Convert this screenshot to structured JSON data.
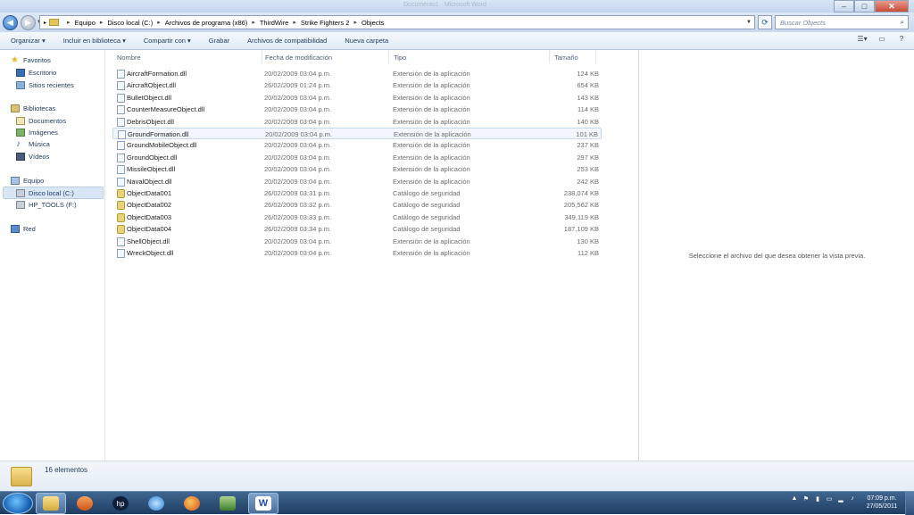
{
  "window": {
    "ghost_title_left": "Documento1 - Microsoft Word",
    "controls": [
      "–",
      "□",
      "✕"
    ]
  },
  "address": {
    "segments": [
      "Equipo",
      "Disco local (C:)",
      "Archivos de programa (x86)",
      "ThirdWire",
      "Strike Fighters 2",
      "Objects"
    ],
    "search_placeholder": "Buscar Objects"
  },
  "toolbar": {
    "organize": "Organizar ▾",
    "include": "Incluir en biblioteca ▾",
    "share": "Compartir con ▾",
    "burn": "Grabar",
    "compat": "Archivos de compatibilidad",
    "newfolder": "Nueva carpeta"
  },
  "sidebar": {
    "favorites": "Favoritos",
    "desktop": "Escritorio",
    "recent": "Sitios recientes",
    "libraries": "Bibliotecas",
    "documents": "Documentos",
    "images": "Imágenes",
    "music": "Música",
    "videos": "Vídeos",
    "computer": "Equipo",
    "localdisk": "Disco local (C:)",
    "hptools": "HP_TOOLS (F:)",
    "network": "Red"
  },
  "columns": {
    "name": "Nombre",
    "date": "Fecha de modificación",
    "type": "Tipo",
    "size": "Tamaño"
  },
  "files": [
    {
      "name": "AircraftFormation.dll",
      "date": "20/02/2009 03:04 p.m.",
      "type": "Extensión de la aplicación",
      "size": "124 KB",
      "kind": "dll"
    },
    {
      "name": "AircraftObject.dll",
      "date": "26/02/2009 01:24 p.m.",
      "type": "Extensión de la aplicación",
      "size": "654 KB",
      "kind": "dll"
    },
    {
      "name": "BulletObject.dll",
      "date": "20/02/2009 03:04 p.m.",
      "type": "Extensión de la aplicación",
      "size": "143 KB",
      "kind": "dll"
    },
    {
      "name": "CounterMeasureObject.dll",
      "date": "20/02/2009 03:04 p.m.",
      "type": "Extensión de la aplicación",
      "size": "114 KB",
      "kind": "dll"
    },
    {
      "name": "DebrisObject.dll",
      "date": "20/02/2009 03:04 p.m.",
      "type": "Extensión de la aplicación",
      "size": "140 KB",
      "kind": "dll"
    },
    {
      "name": "GroundFormation.dll",
      "date": "20/02/2009 03:04 p.m.",
      "type": "Extensión de la aplicación",
      "size": "101 KB",
      "kind": "dll"
    },
    {
      "name": "GroundMobileObject.dll",
      "date": "20/02/2009 03:04 p.m.",
      "type": "Extensión de la aplicación",
      "size": "237 KB",
      "kind": "dll"
    },
    {
      "name": "GroundObject.dll",
      "date": "20/02/2009 03:04 p.m.",
      "type": "Extensión de la aplicación",
      "size": "297 KB",
      "kind": "dll"
    },
    {
      "name": "MissileObject.dll",
      "date": "20/02/2009 03:04 p.m.",
      "type": "Extensión de la aplicación",
      "size": "253 KB",
      "kind": "dll"
    },
    {
      "name": "NavalObject.dll",
      "date": "20/02/2009 03:04 p.m.",
      "type": "Extensión de la aplicación",
      "size": "242 KB",
      "kind": "dll"
    },
    {
      "name": "ObjectData001",
      "date": "26/02/2009 03:31 p.m.",
      "type": "Catálogo de seguridad",
      "size": "238,074 KB",
      "kind": "cat"
    },
    {
      "name": "ObjectData002",
      "date": "26/02/2009 03:32 p.m.",
      "type": "Catálogo de seguridad",
      "size": "205,562 KB",
      "kind": "cat"
    },
    {
      "name": "ObjectData003",
      "date": "26/02/2009 03:33 p.m.",
      "type": "Catálogo de seguridad",
      "size": "349,119 KB",
      "kind": "cat"
    },
    {
      "name": "ObjectData004",
      "date": "26/02/2009 03:34 p.m.",
      "type": "Catálogo de seguridad",
      "size": "187,109 KB",
      "kind": "cat"
    },
    {
      "name": "ShellObject.dll",
      "date": "20/02/2009 03:04 p.m.",
      "type": "Extensión de la aplicación",
      "size": "130 KB",
      "kind": "dll"
    },
    {
      "name": "WreckObject.dll",
      "date": "20/02/2009 03:04 p.m.",
      "type": "Extensión de la aplicación",
      "size": "112 KB",
      "kind": "dll"
    }
  ],
  "highlighted_row": "GroundFormation.dll",
  "preview_text": "Seleccione el archivo del que desea obtener la vista previa.",
  "details": {
    "count": "16 elementos"
  },
  "taskbar": {
    "time": "07:09 p.m.",
    "date": "27/05/2011",
    "apps": [
      "explorer",
      "media-player",
      "hp",
      "internet-explorer",
      "firefox",
      "remote-desktop",
      "word"
    ]
  }
}
